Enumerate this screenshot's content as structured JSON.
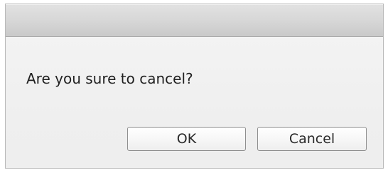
{
  "dialog": {
    "message": "Are you sure to cancel?",
    "buttons": {
      "ok_label": "OK",
      "cancel_label": "Cancel"
    }
  },
  "colors": {
    "titlebar": "#d6d6d6",
    "body": "#f0f0ef",
    "border": "#8f8f8f",
    "text": "#1f1f1f"
  }
}
